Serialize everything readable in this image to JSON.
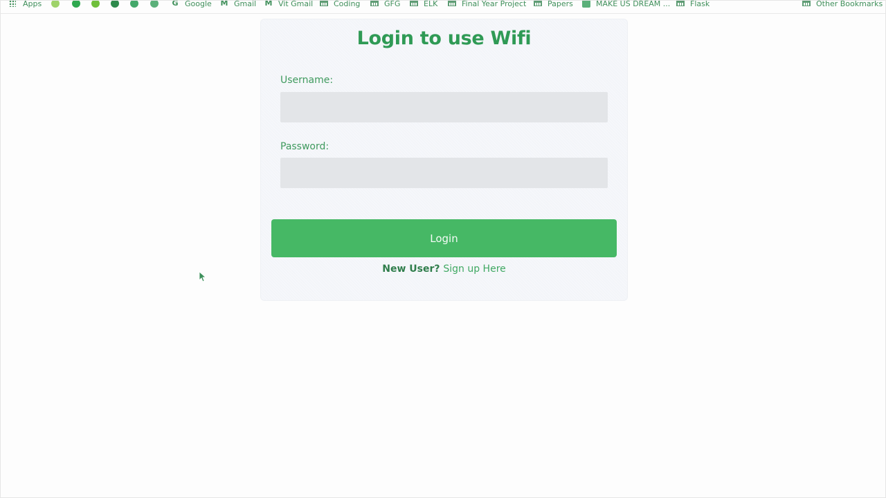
{
  "bookmarks": {
    "items": [
      {
        "label": "Apps",
        "icon": "apps-grid-icon"
      },
      {
        "label": "",
        "icon": "site-icon"
      },
      {
        "label": "",
        "icon": "whatsapp-icon"
      },
      {
        "label": "",
        "icon": "site-icon"
      },
      {
        "label": "",
        "icon": "github-icon"
      },
      {
        "label": "",
        "icon": "site-icon"
      },
      {
        "label": "",
        "icon": "site-icon"
      },
      {
        "label": "Google",
        "icon": "google-icon"
      },
      {
        "label": "Gmail",
        "icon": "gmail-icon"
      },
      {
        "label": "Vit Gmail",
        "icon": "gmail-icon"
      },
      {
        "label": "Coding",
        "icon": "folder-icon"
      },
      {
        "label": "GFG",
        "icon": "folder-icon"
      },
      {
        "label": "ELK",
        "icon": "folder-icon"
      },
      {
        "label": "Final Year Project",
        "icon": "folder-icon"
      },
      {
        "label": "Papers",
        "icon": "folder-icon"
      },
      {
        "label": "MAKE US DREAM ...",
        "icon": "site-icon"
      },
      {
        "label": "Flask",
        "icon": "folder-icon"
      }
    ],
    "other_label": "Other Bookmarks"
  },
  "login": {
    "title": "Login to use Wifi",
    "username_label": "Username:",
    "username_value": "",
    "password_label": "Password:",
    "password_value": "",
    "button_label": "Login",
    "new_user_text": "New User?",
    "signup_link": "Sign up Here"
  },
  "colors": {
    "accent": "#46b865",
    "title": "#2f9a55",
    "input_bg": "#e3e5e8",
    "card_bg": "#f3f5f9"
  }
}
